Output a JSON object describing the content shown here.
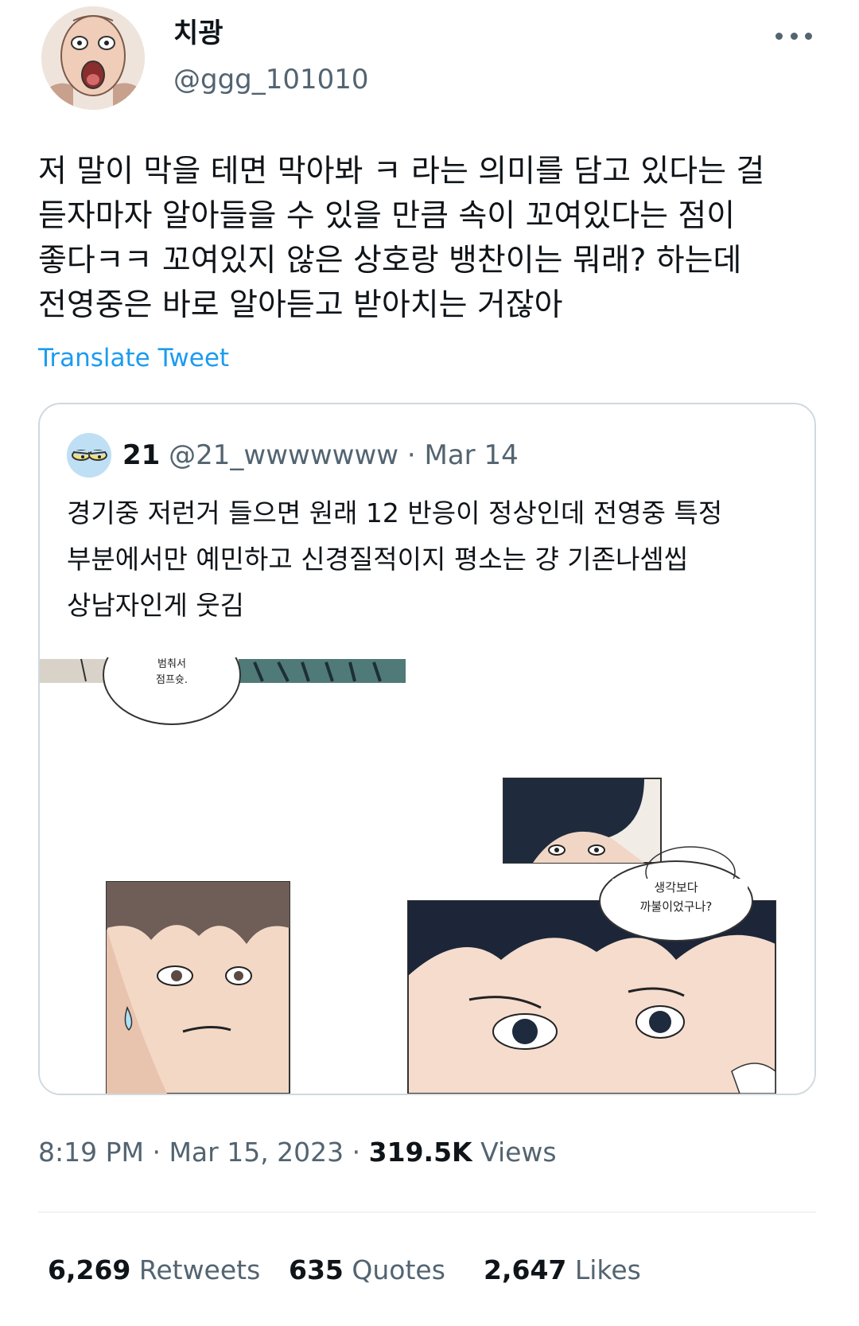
{
  "author": {
    "name": "치광",
    "handle": "@ggg_101010"
  },
  "tweet": {
    "lines": [
      "저 말이 막을 테면 막아봐 ㅋ 라는 의미를 담고 있다는 걸",
      "듣자마자 알아들을 수 있을 만큼 속이 꼬여있다는 점이",
      "좋다ㅋㅋ 꼬여있지 않은 상호랑 뱅찬이는 뭐래? 하는데",
      "전영중은 바로 알아듣고 받아치는 거잖아"
    ],
    "translate_label": "Translate Tweet"
  },
  "quote": {
    "name": "21",
    "handle": "@21_wwwwwww",
    "separator": "·",
    "date": "Mar 14",
    "lines": [
      "경기중 저런거 들으면 원래 12 반응이 정상인데 전영중 특정",
      "부분에서만 예민하고 신경질적이지  평소는 걍 기존나셈씹",
      "상남자인게 웃김"
    ],
    "media": {
      "panel1_text": [
        "범춰서",
        "점프슛."
      ],
      "panel2_text": [
        "생각보다",
        "까불이었구나?"
      ]
    }
  },
  "meta": {
    "time": "8:19 PM",
    "sep1": " · ",
    "date": "Mar 15, 2023",
    "sep2": " · ",
    "views_count": "319.5K",
    "views_label": " Views"
  },
  "stats": {
    "retweets_count": "6,269",
    "retweets_label": " Retweets",
    "quotes_count": "635",
    "quotes_label": " Quotes",
    "likes_count": "2,647",
    "likes_label": " Likes"
  },
  "colors": {
    "text": "#0f1419",
    "muted": "#536471",
    "link": "#1d9bf0",
    "border": "#cfd9de"
  }
}
